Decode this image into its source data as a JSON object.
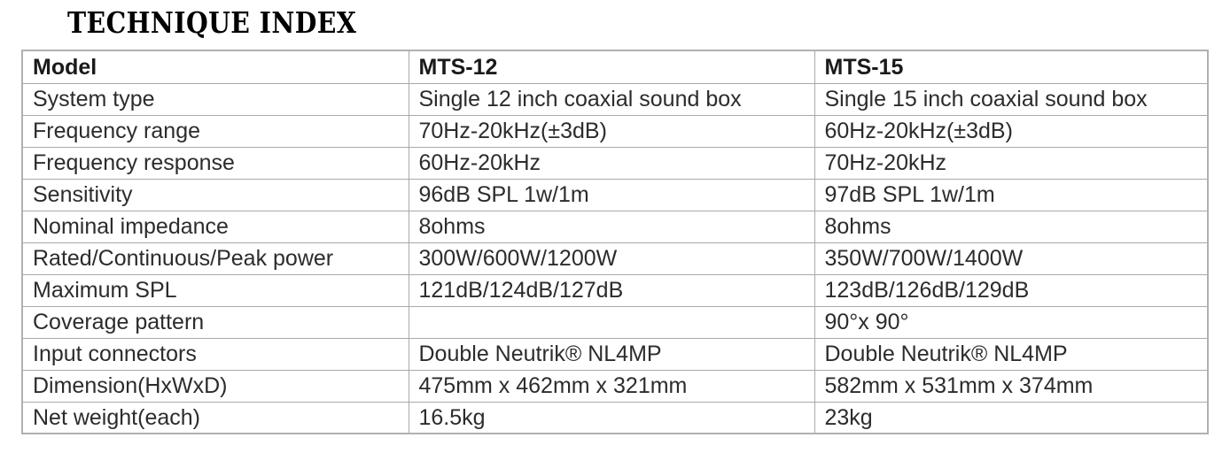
{
  "document": {
    "title": "TECHNIQUE INDEX"
  },
  "colors": {
    "text": "#2c2c2c",
    "heading": "#000000",
    "gridline": "#a9a9a9",
    "outer_border": "#b0b0b0",
    "background": "#ffffff"
  },
  "table": {
    "columns": [
      {
        "key": "label",
        "header": "Model"
      },
      {
        "key": "mts12",
        "header": "MTS-12"
      },
      {
        "key": "mts15",
        "header": "MTS-15"
      }
    ],
    "rows": [
      {
        "label": "System type",
        "mts12": "Single 12 inch coaxial sound box",
        "mts15": "Single 15 inch coaxial sound box"
      },
      {
        "label": "Frequency range",
        "mts12": "70Hz-20kHz(±3dB)",
        "mts15": "60Hz-20kHz(±3dB)"
      },
      {
        "label": "Frequency response",
        "mts12": "60Hz-20kHz",
        "mts15": "70Hz-20kHz"
      },
      {
        "label": "Sensitivity",
        "mts12": "96dB SPL 1w/1m",
        "mts15": "97dB SPL 1w/1m"
      },
      {
        "label": "Nominal impedance",
        "mts12": "8ohms",
        "mts15": "8ohms"
      },
      {
        "label": "Rated/Continuous/Peak power",
        "mts12": "300W/600W/1200W",
        "mts15": "350W/700W/1400W"
      },
      {
        "label": "Maximum SPL",
        "mts12": "121dB/124dB/127dB",
        "mts15": "123dB/126dB/129dB"
      },
      {
        "label": "Coverage pattern",
        "mts12": "",
        "mts15": "90°x 90°"
      },
      {
        "label": "Input connectors",
        "mts12": "Double Neutrik® NL4MP",
        "mts15": "Double Neutrik® NL4MP"
      },
      {
        "label": "Dimension(HxWxD)",
        "mts12": "475mm x 462mm x 321mm",
        "mts15": "582mm x 531mm x 374mm"
      },
      {
        "label": "Net weight(each)",
        "mts12": "16.5kg",
        "mts15": "23kg"
      }
    ]
  }
}
